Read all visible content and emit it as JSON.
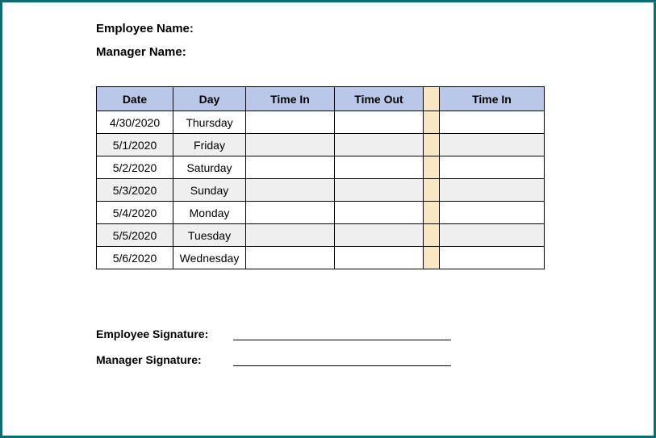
{
  "labels": {
    "employee_name": "Employee Name:",
    "manager_name": "Manager Name:",
    "employee_signature": "Employee Signature:",
    "manager_signature": "Manager Signature:"
  },
  "headers": {
    "date": "Date",
    "day": "Day",
    "time_in": "Time In",
    "time_out": "Time Out",
    "time_in2": "Time In"
  },
  "rows": [
    {
      "date": "4/30/2020",
      "day": "Thursday",
      "time_in": "",
      "time_out": "",
      "time_in2": ""
    },
    {
      "date": "5/1/2020",
      "day": "Friday",
      "time_in": "",
      "time_out": "",
      "time_in2": ""
    },
    {
      "date": "5/2/2020",
      "day": "Saturday",
      "time_in": "",
      "time_out": "",
      "time_in2": ""
    },
    {
      "date": "5/3/2020",
      "day": "Sunday",
      "time_in": "",
      "time_out": "",
      "time_in2": ""
    },
    {
      "date": "5/4/2020",
      "day": "Monday",
      "time_in": "",
      "time_out": "",
      "time_in2": ""
    },
    {
      "date": "5/5/2020",
      "day": "Tuesday",
      "time_in": "",
      "time_out": "",
      "time_in2": ""
    },
    {
      "date": "5/6/2020",
      "day": "Wednesday",
      "time_in": "",
      "time_out": "",
      "time_in2": ""
    }
  ]
}
